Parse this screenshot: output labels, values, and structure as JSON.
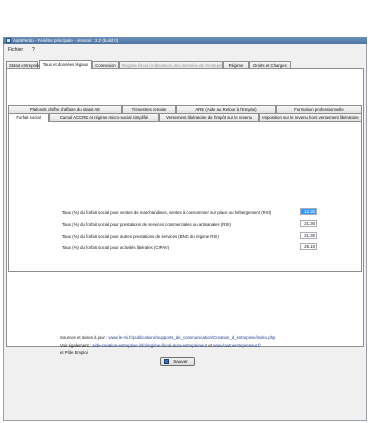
{
  "window": {
    "title": "AutoPerdu - Fenêtre principale - Version : 2.2 (build 0)"
  },
  "menu": {
    "items": [
      "Fichier",
      "?"
    ]
  },
  "main_tabs": [
    {
      "label": "Statut entreprise",
      "active": false,
      "disabled": false
    },
    {
      "label": "Taux et données légaux",
      "active": true,
      "disabled": false
    },
    {
      "label": "Connexion",
      "active": false,
      "disabled": false
    },
    {
      "label": "Régime fiscal / indicateurs des données de l'entreprise",
      "active": false,
      "disabled": true
    },
    {
      "label": "Régime",
      "active": false,
      "disabled": false
    },
    {
      "label": "Droits et Charges",
      "active": false,
      "disabled": false
    }
  ],
  "sub_tabs_row1": [
    "Plafonds chiffre d'affaire du statut AE",
    "Trimestres retraite",
    "ARE (Aide au Retour à l'Emploi)",
    "Formation professionnelle"
  ],
  "sub_tabs_row2": [
    "Forfait social",
    "Cumul ACCRE et régime micro-social simplifié",
    "Versement libératoire de l'impôt sur le revenu",
    "Imposition sur le revenu hors versement libératoire"
  ],
  "rates": [
    {
      "label": "Taux (%) du forfait social pour ventes de marchandises, ventes à consommer sur place ou hébergement (RSI)",
      "value": "12.30",
      "selected": true
    },
    {
      "label": "Taux (%) du forfait social pour prestations de services commerciales ou artisanales (RSI)",
      "value": "21.30",
      "selected": false
    },
    {
      "label": "Taux (%) du forfait social pour autres prestations de services (BNC du régime RSI)",
      "value": "21.30",
      "selected": false
    },
    {
      "label": "Taux (%) du forfait social pour activités libérales (CIPAV)",
      "value": "26.10",
      "selected": false
    }
  ],
  "sources": {
    "prefix": "Sources et mises à jour :",
    "link1": "www.le-rsi.fr/publications/supports_de_communication/Creation_d_entreprise/index.php",
    "also_prefix": "Voir également :",
    "link2": "aide-creation-entreprise.info/regime-fiscal-auto-entrepreneur",
    "and": "et",
    "link3": "www.lautoentrepreneur.fr",
    "suffix": "et Pôle Emploi"
  },
  "save_button": {
    "label": "Sauver"
  },
  "colors": {
    "selection": "#3399ff",
    "link": "#1a3d8f",
    "titlebar": "#4f74a3"
  }
}
